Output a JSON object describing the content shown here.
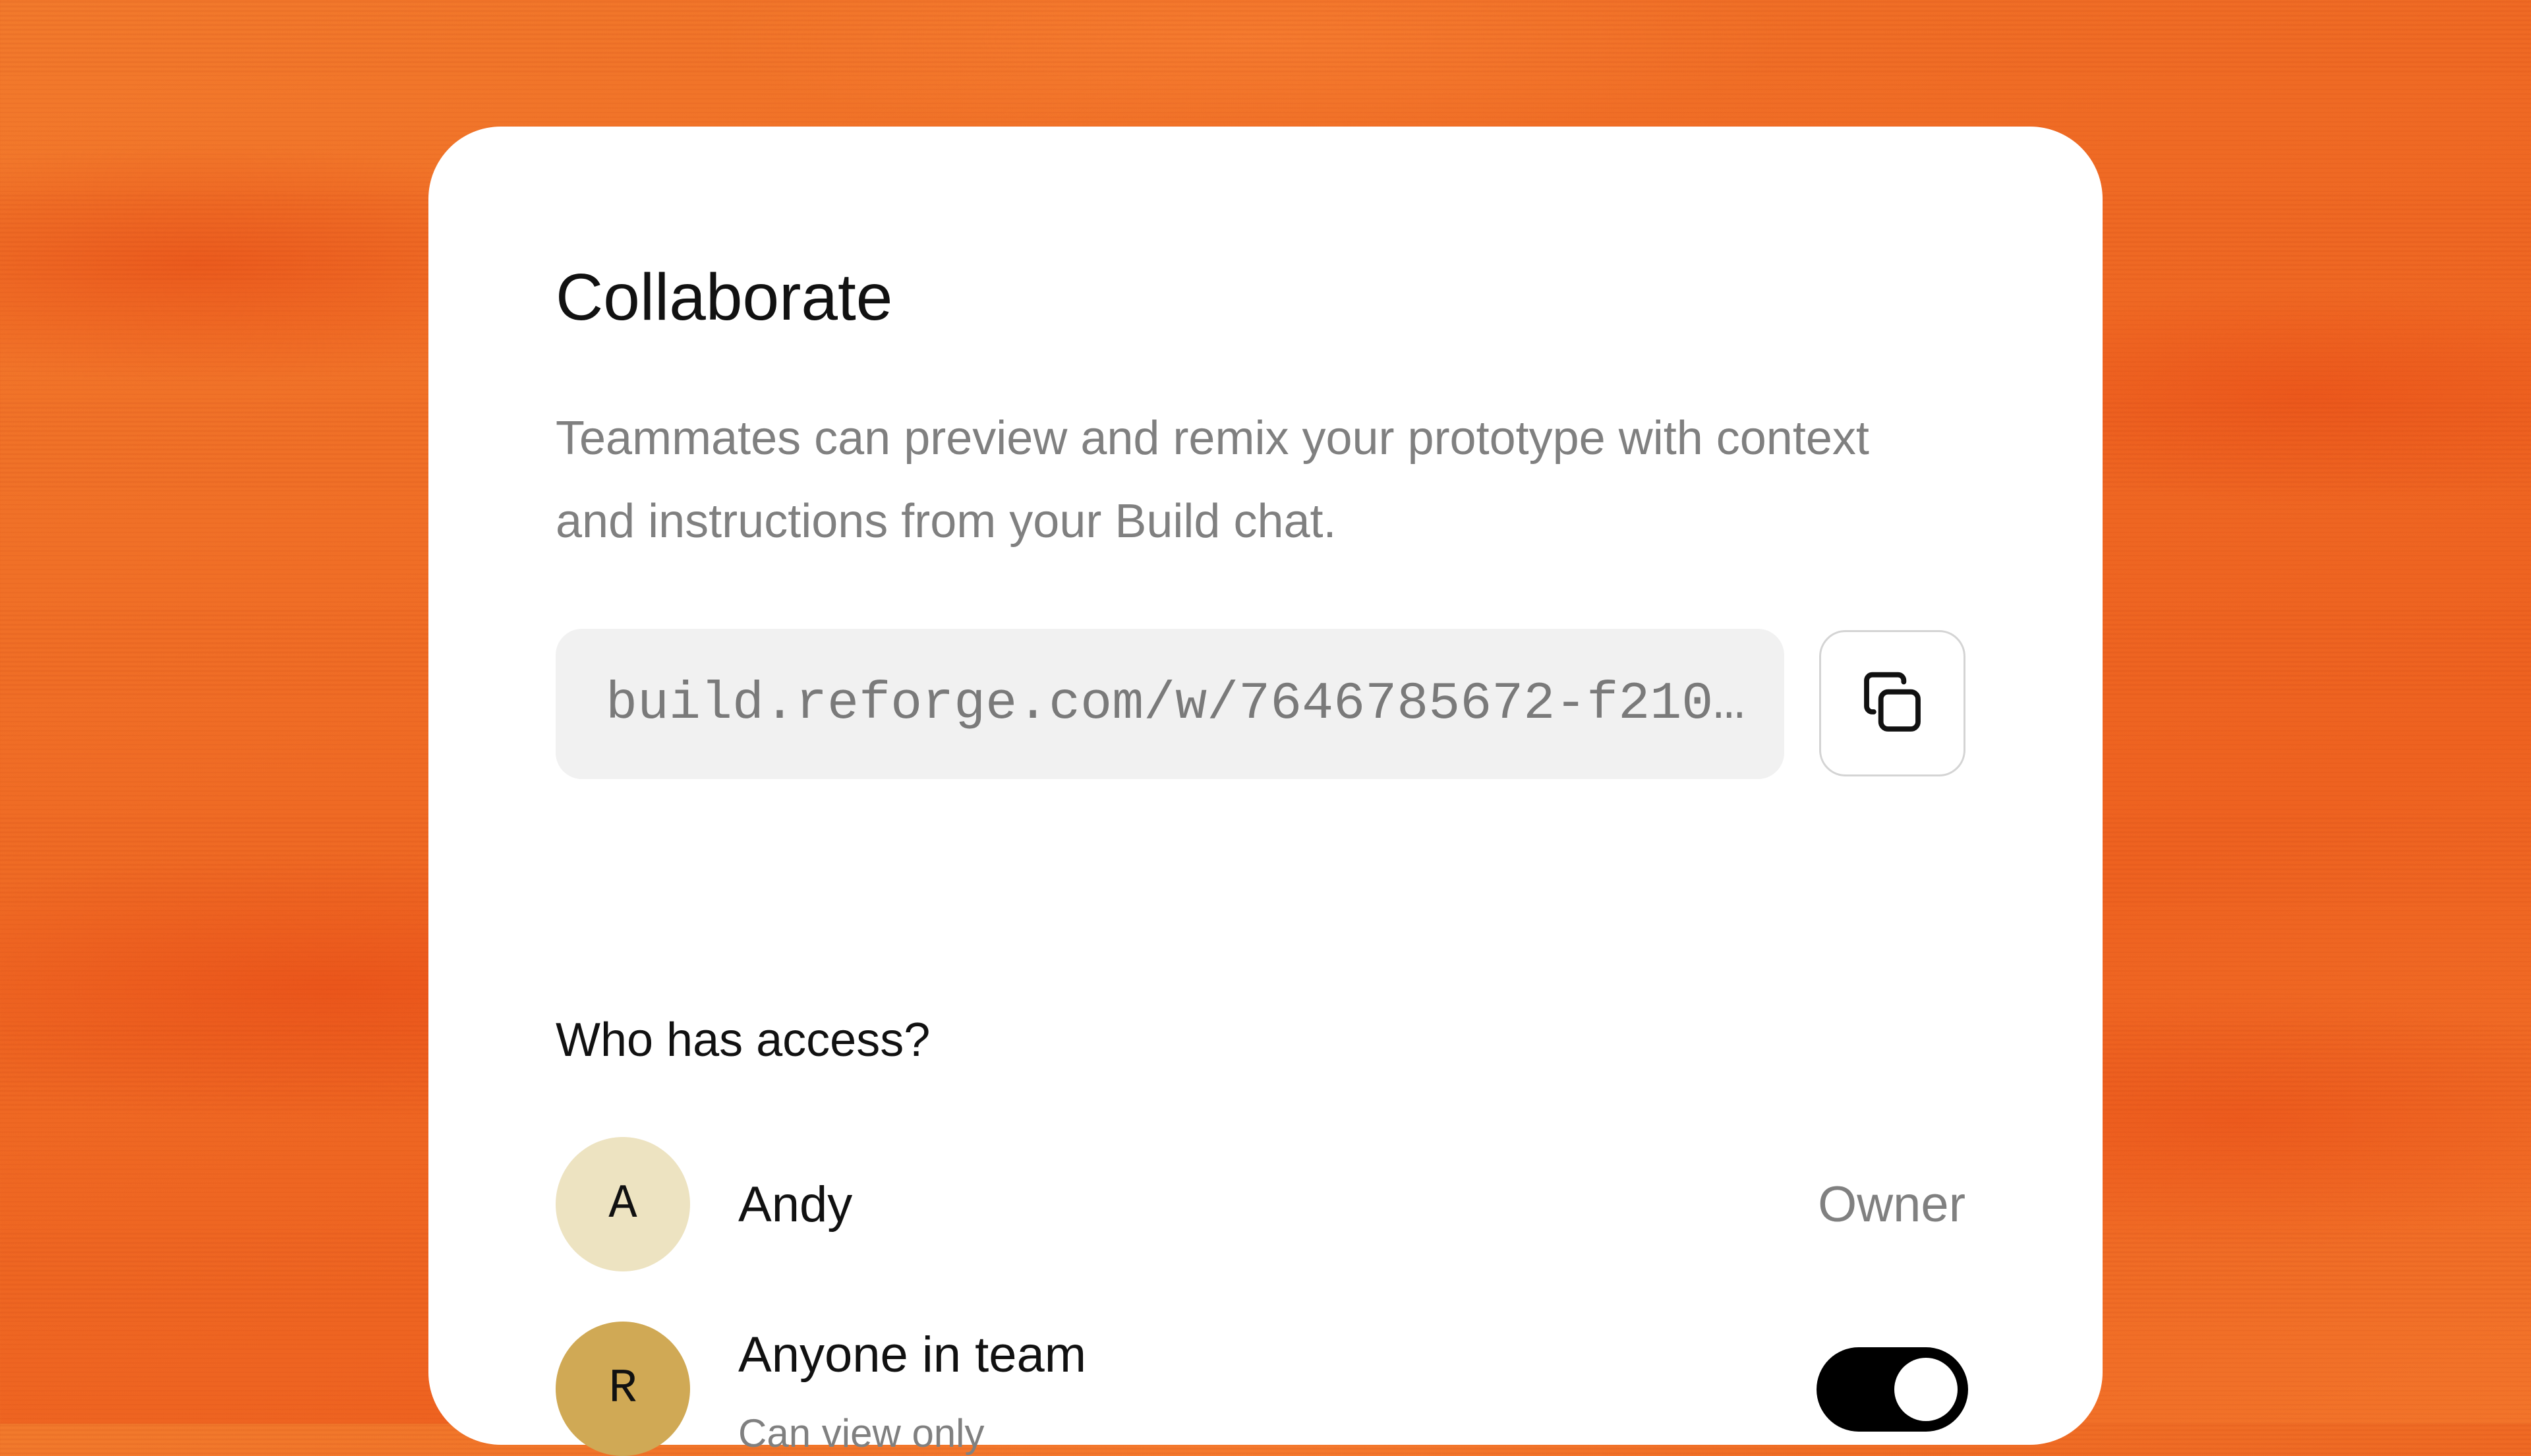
{
  "dialog": {
    "title": "Collaborate",
    "description": "Teammates can preview and remix your prototype with context and instructions from your Build chat.",
    "share_url": "build.reforge.com/w/7646785672-f210…",
    "copy_icon": "copy-icon"
  },
  "access": {
    "heading": "Who has access?",
    "members": [
      {
        "initial": "A",
        "name": "Andy",
        "role": "Owner",
        "avatar_color": "#ede3c1"
      },
      {
        "initial": "R",
        "name": "Anyone in team",
        "subtitle": "Can view only",
        "avatar_color": "#d0a955",
        "toggle_on": true
      }
    ]
  },
  "colors": {
    "background": "#f06a22",
    "card": "#ffffff",
    "toggle_on": "#000000"
  }
}
